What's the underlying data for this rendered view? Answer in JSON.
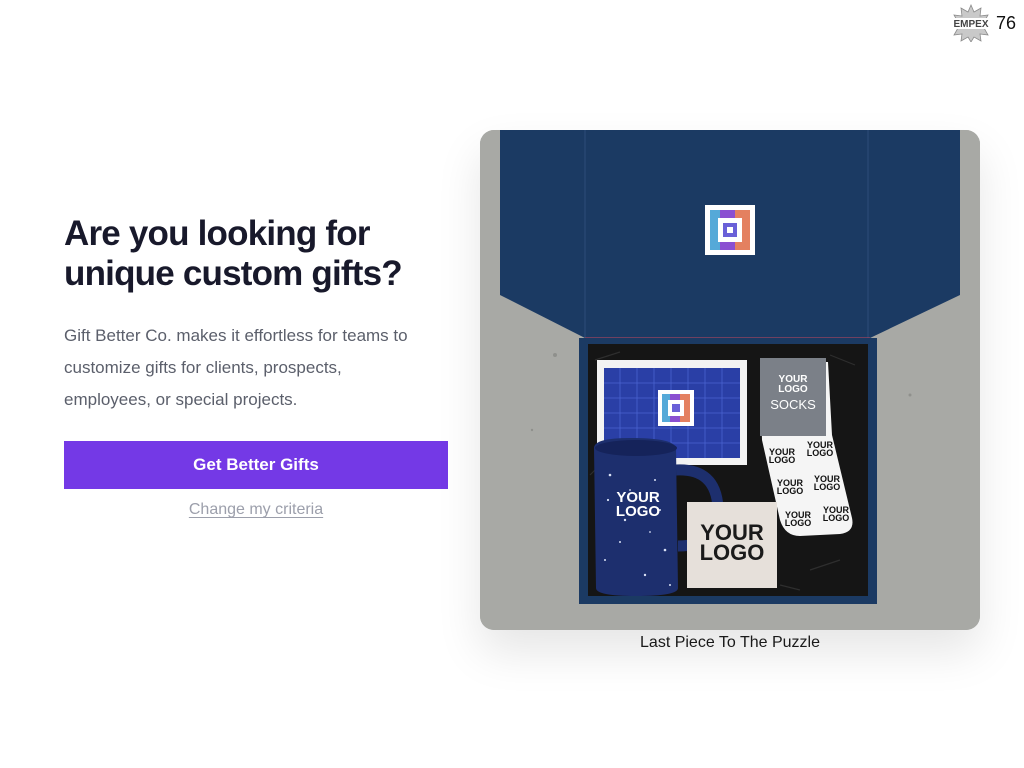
{
  "brand": {
    "seal_text": "EMPEX",
    "page_count": "76"
  },
  "hero": {
    "title_line1": "Are you looking for",
    "title_line2": "unique custom gifts?",
    "description_line1": "Gift Better Co. makes it effortless for teams to",
    "description_line2": "customize gifts for clients, prospects,",
    "description_line3": "employees, or special projects.",
    "cta_label": "Get Better Gifts",
    "secondary_link": "Change my criteria"
  },
  "product": {
    "caption": "Last Piece To The Puzzle",
    "mug_text_line1": "YOUR",
    "mug_text_line2": "LOGO",
    "coaster_text_line1": "YOUR",
    "coaster_text_line2": "LOGO",
    "socks_text_line1": "YOUR",
    "socks_text_line2": "LOGO",
    "socks_label": "SOCKS"
  },
  "colors": {
    "accent": "#7439e6",
    "navy": "#1b3a63",
    "heading": "#18192b",
    "body_text": "#5b5f6b",
    "link": "#9c9fab"
  }
}
